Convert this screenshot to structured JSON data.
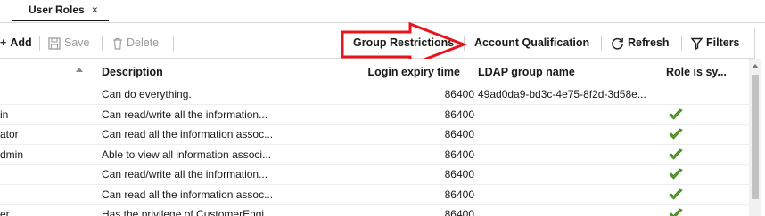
{
  "tab": {
    "label": "User Roles",
    "close": "×"
  },
  "toolbar": {
    "add": "Add",
    "save": "Save",
    "delete": "Delete",
    "group_restrictions": "Group Restrictions",
    "account_qualification": "Account Qualification",
    "refresh": "Refresh",
    "filters": "Filters"
  },
  "columns": {
    "description": "Description",
    "login_expiry": "Login expiry time",
    "ldap": "LDAP group name",
    "role_system": "Role is sy..."
  },
  "rows": [
    {
      "name": "",
      "description": "Can do everything.",
      "login_expiry": "86400",
      "ldap": "49ad0da9-bd3c-4e75-8f2d-3d58e...",
      "system": false
    },
    {
      "name": "in",
      "description": "Can read/write all the information...",
      "login_expiry": "86400",
      "ldap": "",
      "system": true
    },
    {
      "name": "ator",
      "description": "Can read all the information assoc...",
      "login_expiry": "86400",
      "ldap": "",
      "system": true
    },
    {
      "name": "dmin",
      "description": "Able to view all information associ...",
      "login_expiry": "86400",
      "ldap": "",
      "system": true
    },
    {
      "name": "",
      "description": "Can read/write all the information...",
      "login_expiry": "86400",
      "ldap": "",
      "system": true
    },
    {
      "name": "",
      "description": "Can read all the information assoc...",
      "login_expiry": "86400",
      "ldap": "",
      "system": true
    },
    {
      "name": "er",
      "description": "Has the privilege of CustomerEngi...",
      "login_expiry": "86400",
      "ldap": "",
      "system": true
    }
  ],
  "colors": {
    "check": "#5aa02c",
    "arrow": "#e8141c"
  }
}
